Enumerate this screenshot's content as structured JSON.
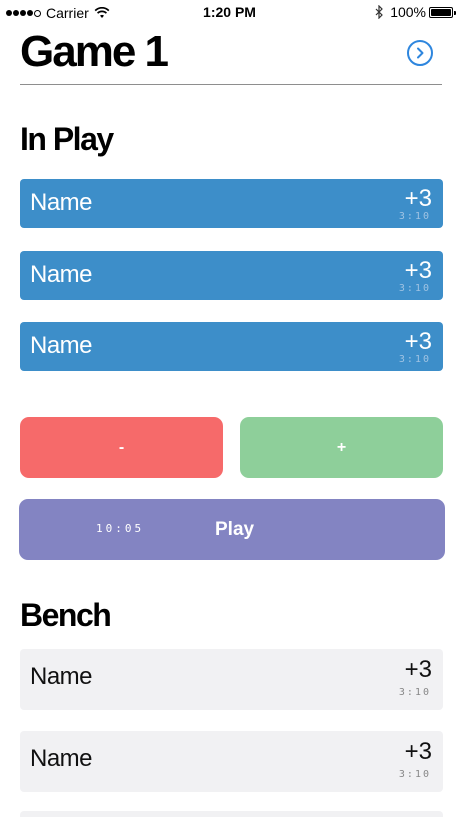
{
  "status_bar": {
    "carrier": "Carrier",
    "time": "1:20 PM",
    "battery": "100%"
  },
  "header": {
    "title": "Game 1"
  },
  "in_play": {
    "title": "In Play",
    "players": [
      {
        "name": "Name",
        "score": "+3",
        "time": "3:10"
      },
      {
        "name": "Name",
        "score": "+3",
        "time": "3:10"
      },
      {
        "name": "Name",
        "score": "+3",
        "time": "3:10"
      }
    ]
  },
  "controls": {
    "minus_label": "-",
    "plus_label": "+",
    "clock": "10:05",
    "play_label": "Play"
  },
  "bench": {
    "title": "Bench",
    "players": [
      {
        "name": "Name",
        "score": "+3",
        "time": "3:10"
      },
      {
        "name": "Name",
        "score": "+3",
        "time": "3:10"
      }
    ]
  },
  "colors": {
    "in_play_row": "#3d8ec9",
    "bench_row": "#f1f1f3",
    "minus": "#f66a6a",
    "plus": "#8ecf9a",
    "play": "#8384c2",
    "accent": "#2e86de"
  },
  "icons": {
    "next": "chevron-right-circle-icon",
    "wifi": "wifi-icon",
    "bluetooth": "bluetooth-icon",
    "battery": "battery-icon"
  }
}
